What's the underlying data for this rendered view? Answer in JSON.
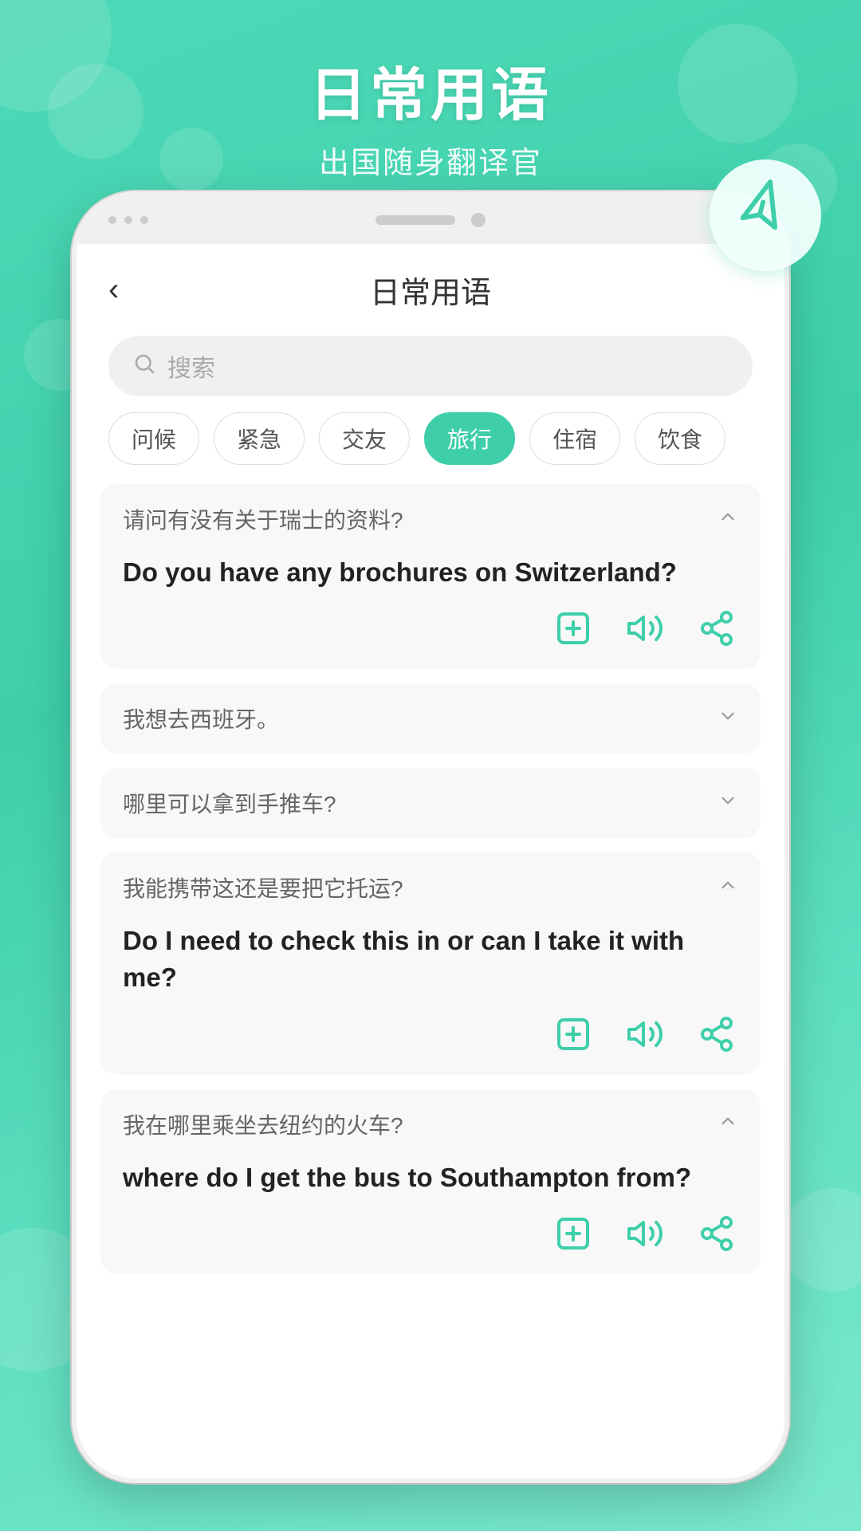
{
  "header": {
    "title": "日常用语",
    "subtitle": "出国随身翻译官"
  },
  "app": {
    "back_label": "‹",
    "nav_title": "日常用语",
    "search_placeholder": "搜索"
  },
  "categories": [
    {
      "id": "greet",
      "label": "问候",
      "active": false
    },
    {
      "id": "urgent",
      "label": "紧急",
      "active": false
    },
    {
      "id": "social",
      "label": "交友",
      "active": false
    },
    {
      "id": "travel",
      "label": "旅行",
      "active": true
    },
    {
      "id": "stay",
      "label": "住宿",
      "active": false
    },
    {
      "id": "food",
      "label": "饮食",
      "active": false
    }
  ],
  "phrases": [
    {
      "id": 1,
      "cn": "请问有没有关于瑞士的资料?",
      "en": "Do you have any brochures on Switzerland?",
      "expanded": true
    },
    {
      "id": 2,
      "cn": "我想去西班牙。",
      "en": "",
      "expanded": false
    },
    {
      "id": 3,
      "cn": "哪里可以拿到手推车?",
      "en": "",
      "expanded": false
    },
    {
      "id": 4,
      "cn": "我能携带这还是要把它托运?",
      "en": "Do I need to check this in or can I take it with me?",
      "expanded": true
    },
    {
      "id": 5,
      "cn": "我在哪里乘坐去纽约的火车?",
      "en": "where do I get the bus to Southampton from?",
      "expanded": true
    }
  ],
  "actions": {
    "add_label": "add",
    "sound_label": "sound",
    "share_label": "share"
  },
  "colors": {
    "primary": "#3ecfaa",
    "text_dark": "#222222",
    "text_medium": "#666666",
    "text_light": "#aaaaaa",
    "bg_card": "#f8f8f8",
    "bg_search": "#f0f0f0"
  }
}
